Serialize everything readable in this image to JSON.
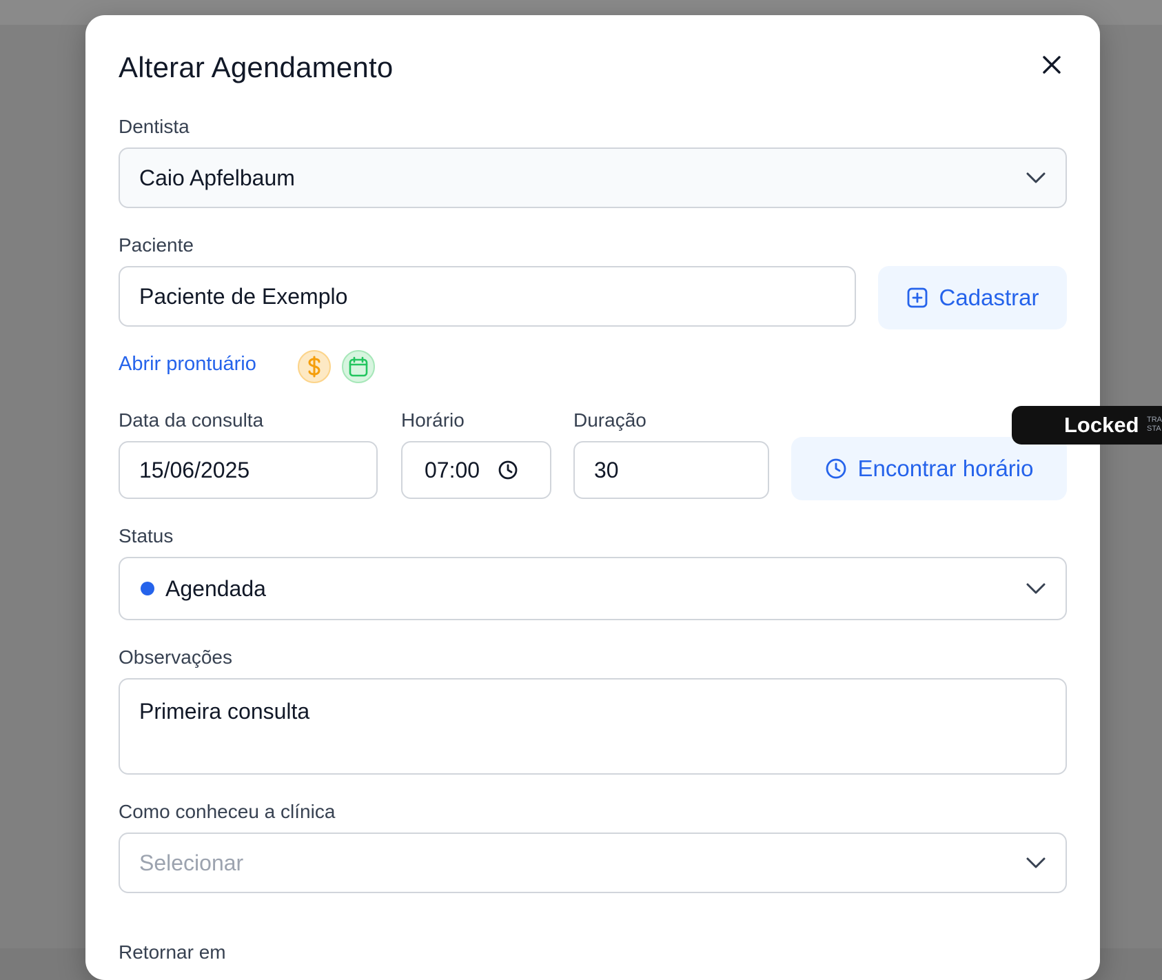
{
  "modal": {
    "title": "Alterar Agendamento"
  },
  "dentista": {
    "label": "Dentista",
    "value": "Caio Apfelbaum"
  },
  "paciente": {
    "label": "Paciente",
    "value": "Paciente de Exemplo",
    "cadastrar_label": "Cadastrar",
    "abrir_prontuario": "Abrir prontuário"
  },
  "data_consulta": {
    "label": "Data da consulta",
    "value": "15/06/2025"
  },
  "horario": {
    "label": "Horário",
    "value": "07:00"
  },
  "duracao": {
    "label": "Duração",
    "value": "30"
  },
  "encontrar_horario_label": "Encontrar horário",
  "status": {
    "label": "Status",
    "value": "Agendada",
    "dot_color": "#2563eb"
  },
  "observacoes": {
    "label": "Observações",
    "value": "Primeira consulta"
  },
  "como_conheceu": {
    "label": "Como conheceu a clínica",
    "placeholder": "Selecionar"
  },
  "retornar_em": {
    "label": "Retornar em"
  },
  "locked_badge": {
    "label": "Locked",
    "line1": "TRA",
    "line2": "STA"
  },
  "colors": {
    "accent": "#2563eb",
    "soft_accent_bg": "#eff6ff",
    "money_icon": "#f59e0b",
    "calendar_icon": "#22c55e"
  },
  "icons": {
    "close": "close-icon",
    "chevron": "chevron-down-icon",
    "add": "plus-square-icon",
    "money": "dollar-icon",
    "calendar": "calendar-icon",
    "clock": "clock-icon"
  }
}
